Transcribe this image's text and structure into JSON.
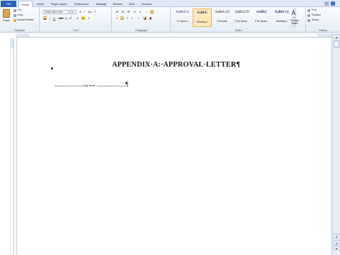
{
  "tabs": {
    "file": "File",
    "home": "Home",
    "insert": "Insert",
    "page_layout": "Page Layout",
    "references": "References",
    "mailings": "Mailings",
    "review": "Review",
    "view": "View",
    "acrobat": "Acrobat"
  },
  "clipboard": {
    "paste": "Paste",
    "cut": "Cut",
    "copy": "Copy",
    "format_painter": "Format Painter",
    "label": "Clipboard"
  },
  "font": {
    "name": "Times New Rom",
    "size": "14",
    "label": "Font"
  },
  "paragraph": {
    "label": "Paragraph"
  },
  "styles": {
    "label": "Styles",
    "items": [
      {
        "sample": "AaBbCcI",
        "name": "¶ Caption"
      },
      {
        "sample": "AaBbC",
        "name": "Heading 1"
      },
      {
        "sample": "AaBbCcD",
        "name": "¶ Normal"
      },
      {
        "sample": "AaBbCcD",
        "name": "¶ No Spaci..."
      },
      {
        "sample": "AaBbC",
        "name": "¶ No Spaci..."
      },
      {
        "sample": "AaBbCcI",
        "name": "Heading 2"
      }
    ],
    "change_styles": "Change Styles"
  },
  "editing": {
    "find": "Find",
    "replace": "Replace",
    "select": "Select",
    "label": "Editing"
  },
  "document": {
    "heading": "APPENDIX·A:·APPROVAL·LETTER¶",
    "page_break": "Page Break",
    "pilcrow": "¶"
  },
  "colors": {
    "file_tab": "#2a62b8",
    "heading_style": "#1f3f77"
  }
}
